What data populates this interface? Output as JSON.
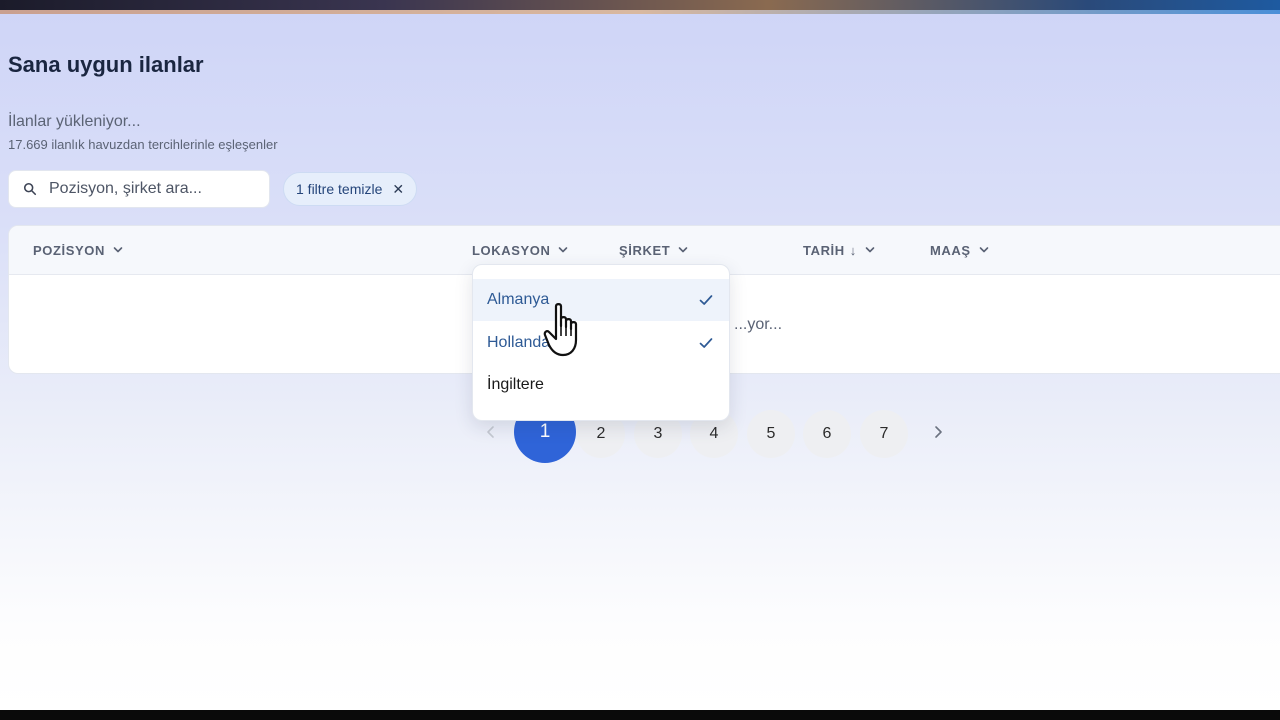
{
  "page": {
    "title": "Sana uygun ilanlar",
    "loading_text": "İlanlar yükleniyor...",
    "count_text": "17.669 ilanlık havuzdan tercihlerinle eşleşenler"
  },
  "search": {
    "placeholder": "Pozisyon, şirket ara..."
  },
  "filter_chip": {
    "label": "1 filtre temizle",
    "close": "✕"
  },
  "table": {
    "columns": [
      {
        "label": "POZİSYON"
      },
      {
        "label": "LOKASYON"
      },
      {
        "label": "ŞİRKET"
      },
      {
        "label": "TARİH",
        "sort": "↓"
      },
      {
        "label": "MAAŞ"
      }
    ],
    "body_text": "...yor..."
  },
  "location_dropdown": {
    "options": [
      {
        "label": "Almanya",
        "selected": true
      },
      {
        "label": "Hollanda",
        "selected": true
      },
      {
        "label": "İngiltere",
        "selected": false
      }
    ]
  },
  "pagination": {
    "current": 1,
    "pages": [
      "1",
      "2",
      "3",
      "4",
      "5",
      "6",
      "7"
    ]
  },
  "colors": {
    "accent": "#2f64d8",
    "selected_text": "#2e5a95",
    "title": "#1a2640"
  },
  "icons": {
    "search": "search-icon",
    "close": "close-icon",
    "chevron": "chevron-down-icon",
    "check": "check-icon",
    "prev": "chevron-left-icon",
    "next": "chevron-right-icon",
    "cursor": "hand-pointer-icon"
  }
}
